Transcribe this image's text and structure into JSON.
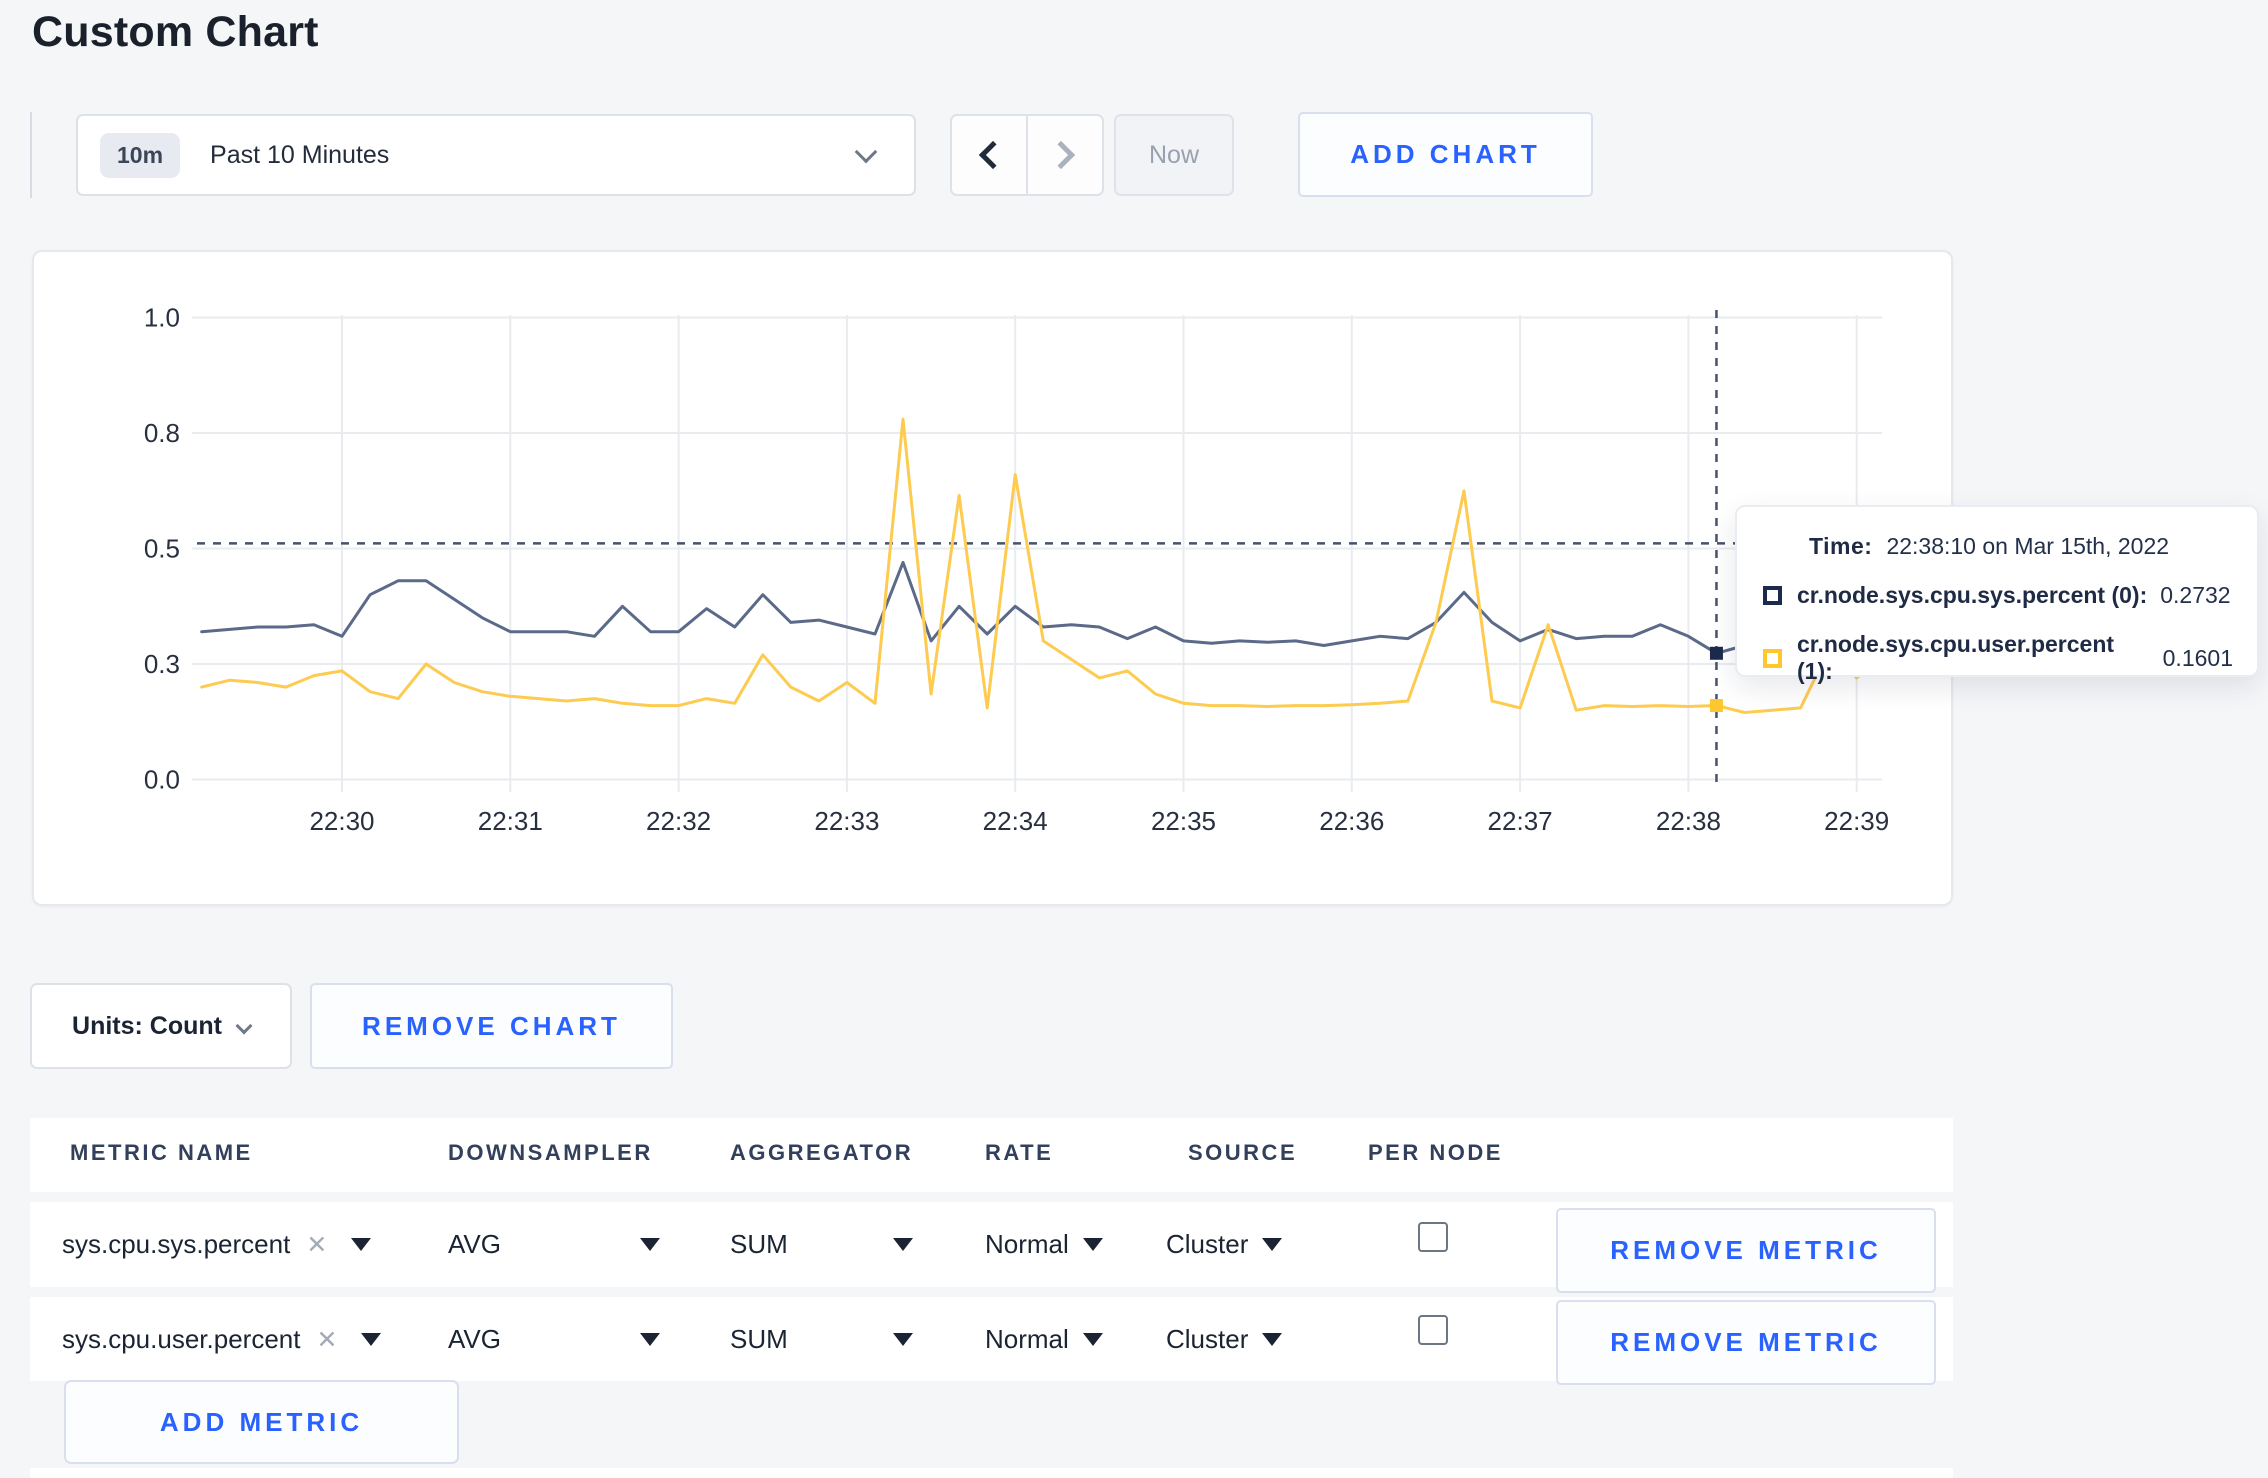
{
  "page": {
    "title": "Custom Chart"
  },
  "colors": {
    "accent_blue": "#2962ff",
    "navy_text": "#1f2a44",
    "page_background": "#f5f6f8",
    "grid": "#e9ebee",
    "crosshair_dash": "#46536f"
  },
  "controls": {
    "time_window": {
      "badge": "10m",
      "label": "Past 10 Minutes"
    },
    "now_label": "Now",
    "add_chart_label": "ADD CHART"
  },
  "tooltip": {
    "time_label": "Time:",
    "time_value": "22:38:10 on Mar 15th, 2022",
    "series": [
      {
        "label": "cr.node.sys.cpu.sys.percent (0):",
        "value": "0.2732"
      },
      {
        "label": "cr.node.sys.cpu.user.percent (1):",
        "value": "0.1601"
      }
    ]
  },
  "units": {
    "label": "Units: Count"
  },
  "buttons": {
    "remove_chart": "REMOVE CHART",
    "add_metric": "ADD METRIC"
  },
  "table": {
    "headers": [
      "METRIC NAME",
      "DOWNSAMPLER",
      "AGGREGATOR",
      "RATE",
      "SOURCE",
      "PER NODE"
    ],
    "rows": [
      {
        "metric": "sys.cpu.sys.percent",
        "remove_icon": "✕",
        "downsampler": "AVG",
        "aggregator": "SUM",
        "rate": "Normal",
        "source": "Cluster",
        "per_node_checked": false,
        "remove_label": "REMOVE METRIC"
      },
      {
        "metric": "sys.cpu.user.percent",
        "remove_icon": "✕",
        "downsampler": "AVG",
        "aggregator": "SUM",
        "rate": "Normal",
        "source": "Cluster",
        "per_node_checked": false,
        "remove_label": "REMOVE METRIC"
      }
    ]
  },
  "chart_data": {
    "type": "line",
    "title": "",
    "xlabel": "",
    "ylabel": "",
    "grid": true,
    "y_range": [
      0,
      1
    ],
    "y_ticks": [
      {
        "value": 0,
        "label": "0.0"
      },
      {
        "value": 0.25,
        "label": "0.3"
      },
      {
        "value": 0.5,
        "label": "0.5"
      },
      {
        "value": 0.75,
        "label": "0.8"
      },
      {
        "value": 1.0,
        "label": "1.0"
      }
    ],
    "x_ticks": [
      "22:30",
      "22:31",
      "22:32",
      "22:33",
      "22:34",
      "22:35",
      "22:36",
      "22:37",
      "22:38",
      "22:39"
    ],
    "start_time": "22:29:10",
    "interval_seconds": 10,
    "series": [
      {
        "name": "cr.node.sys.cpu.sys.percent",
        "line_color": "#5a6a88",
        "swatch_color": "#1c2b4d",
        "values": [
          0.32,
          0.325,
          0.33,
          0.33,
          0.335,
          0.31,
          0.4,
          0.43,
          0.43,
          0.39,
          0.35,
          0.32,
          0.32,
          0.32,
          0.31,
          0.375,
          0.32,
          0.32,
          0.37,
          0.33,
          0.4,
          0.34,
          0.345,
          0.33,
          0.315,
          0.47,
          0.3,
          0.375,
          0.315,
          0.375,
          0.33,
          0.335,
          0.33,
          0.305,
          0.33,
          0.3,
          0.295,
          0.3,
          0.297,
          0.3,
          0.29,
          0.3,
          0.31,
          0.305,
          0.34,
          0.405,
          0.34,
          0.3,
          0.325,
          0.305,
          0.31,
          0.31,
          0.335,
          0.31,
          0.2732,
          0.29,
          0.3,
          0.295,
          0.3,
          0.31,
          0.3
        ]
      },
      {
        "name": "cr.node.sys.cpu.user.percent",
        "line_color": "#fdcb50",
        "swatch_color": "#ffc72e",
        "values": [
          0.2,
          0.215,
          0.21,
          0.2,
          0.225,
          0.235,
          0.19,
          0.175,
          0.25,
          0.21,
          0.19,
          0.18,
          0.175,
          0.17,
          0.175,
          0.165,
          0.16,
          0.16,
          0.175,
          0.165,
          0.27,
          0.2,
          0.17,
          0.21,
          0.165,
          0.78,
          0.185,
          0.615,
          0.155,
          0.66,
          0.3,
          0.26,
          0.22,
          0.235,
          0.185,
          0.165,
          0.16,
          0.16,
          0.158,
          0.16,
          0.16,
          0.162,
          0.165,
          0.17,
          0.34,
          0.625,
          0.17,
          0.155,
          0.335,
          0.15,
          0.16,
          0.158,
          0.16,
          0.158,
          0.1601,
          0.145,
          0.15,
          0.155,
          0.28,
          0.22,
          0.27
        ]
      }
    ],
    "crosshair": {
      "time": "22:38:10",
      "hline_value": 0.511,
      "points": [
        {
          "series": 0,
          "value": 0.2732
        },
        {
          "series": 1,
          "value": 0.1601
        }
      ]
    },
    "legend_position": "tooltip"
  }
}
